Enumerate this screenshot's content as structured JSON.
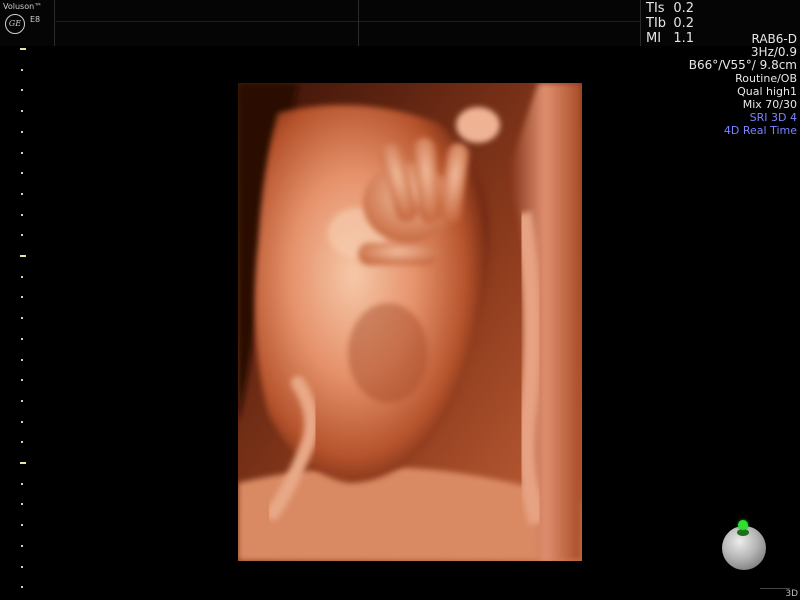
{
  "header": {
    "brand": "Voluson™",
    "logo_text": "GE",
    "model": "E8"
  },
  "safety_indices": [
    {
      "label": "TIs",
      "value": "0.2"
    },
    {
      "label": "TIb",
      "value": "0.2"
    },
    {
      "label": "MI",
      "value": "1.1"
    }
  ],
  "settings": {
    "probe": "RAB6-D",
    "freq": "3Hz/0.9",
    "angles": "B66°/V55°/ 9.8cm",
    "preset": "Routine/OB",
    "quality": "Qual high1",
    "mix": "Mix 70/30",
    "sri": "SRI 3D 4",
    "mode": "4D Real Time"
  },
  "colors": {
    "accent": "#7d83ff",
    "skin_light": "#f2b494",
    "skin_mid": "#d7744a",
    "skin_dark": "#7a2a12",
    "orientation_dot": "#2ee12e"
  },
  "viewport": {
    "mode_badge": "3D"
  }
}
